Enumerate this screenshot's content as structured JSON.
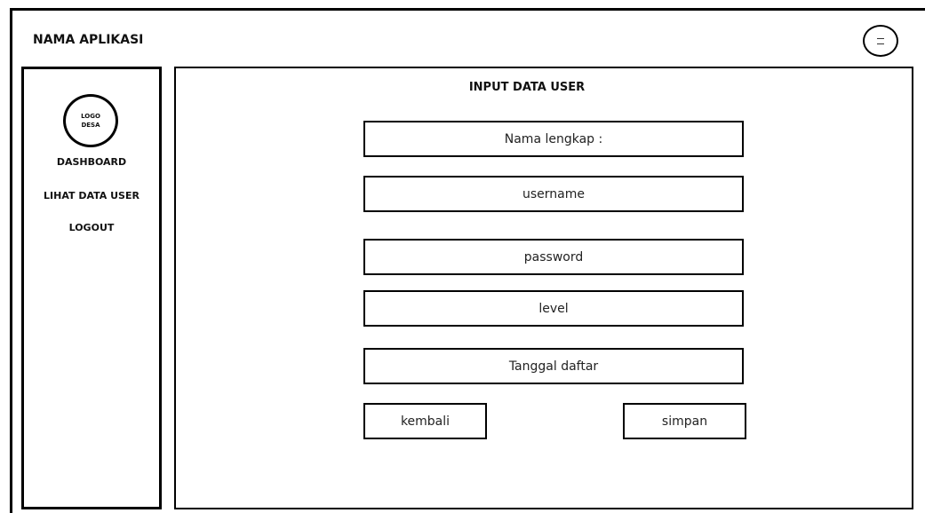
{
  "header": {
    "app_name": "NAMA APLIKASI",
    "menu_icon": "menu-icon"
  },
  "sidebar": {
    "logo_line1": "LOGO",
    "logo_line2": "DESA",
    "items": [
      {
        "label": "DASHBOARD"
      },
      {
        "label": "LIHAT DATA USER"
      },
      {
        "label": "LOGOUT"
      }
    ]
  },
  "main": {
    "title": "INPUT DATA USER",
    "fields": [
      {
        "label": "Nama lengkap :"
      },
      {
        "label": "username"
      },
      {
        "label": "password"
      },
      {
        "label": "level"
      },
      {
        "label": "Tanggal daftar"
      }
    ],
    "back_label": "kembali",
    "save_label": "simpan"
  }
}
